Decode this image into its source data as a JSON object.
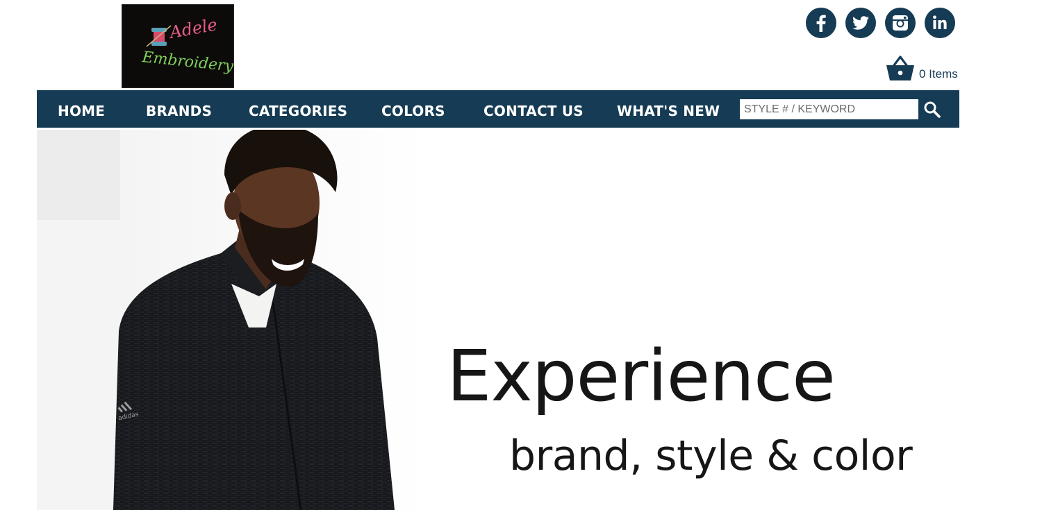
{
  "logo": {
    "line1": "Adele",
    "line2": "Embroidery"
  },
  "social": [
    {
      "name": "facebook",
      "icon": "facebook-icon"
    },
    {
      "name": "twitter",
      "icon": "twitter-icon"
    },
    {
      "name": "instagram",
      "icon": "instagram-icon"
    },
    {
      "name": "linkedin",
      "icon": "linkedin-icon"
    }
  ],
  "cart": {
    "count_label": "0 Items",
    "icon": "basket-icon"
  },
  "nav": {
    "items": [
      "HOME",
      "BRANDS",
      "CATEGORIES",
      "COLORS",
      "CONTACT US",
      "WHAT'S NEW"
    ],
    "search_placeholder": "STYLE # / KEYWORD",
    "search_icon": "search-icon"
  },
  "hero": {
    "title": "Experience",
    "subtitle": "brand, style & color",
    "sleeve_logo": "adidas"
  },
  "colors": {
    "navy": "#163b54",
    "white": "#ffffff",
    "text_dark": "#161616"
  }
}
